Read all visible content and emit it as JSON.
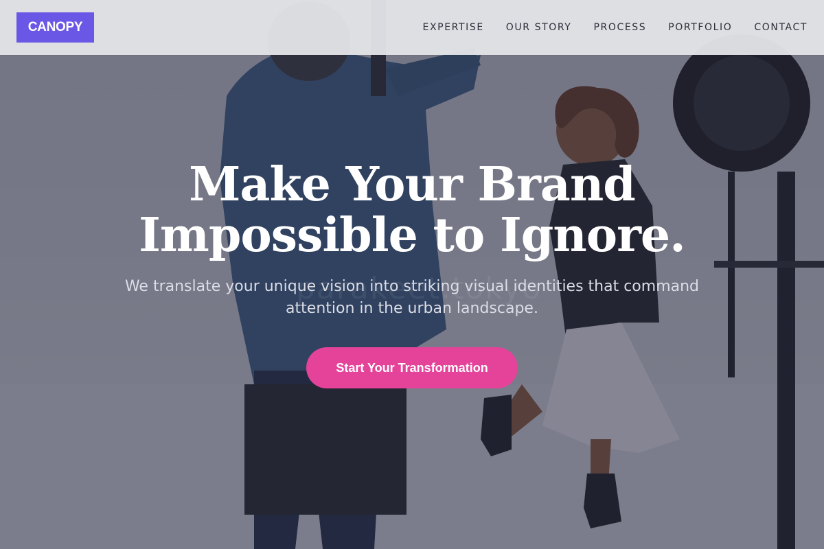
{
  "nav": {
    "logo": "CANOPY",
    "links": [
      "EXPERTISE",
      "OUR STORY",
      "PROCESS",
      "PORTFOLIO",
      "CONTACT"
    ]
  },
  "hero": {
    "headline_line1": "Make Your Brand",
    "headline_line2": "Impossible to Ignore.",
    "subtitle": "We translate your unique vision into striking visual identities that command attention in the urban landscape.",
    "cta_label": "Start Your Transformation",
    "watermark": "parakeet.tokyo"
  },
  "colors": {
    "logo_bg": "#6b57e6",
    "cta_bg": "#e5439a",
    "nav_bg": "#e2e3e7",
    "overlay": "#26283e"
  },
  "icons": {
    "background": "photo-studio-shoot-image"
  }
}
